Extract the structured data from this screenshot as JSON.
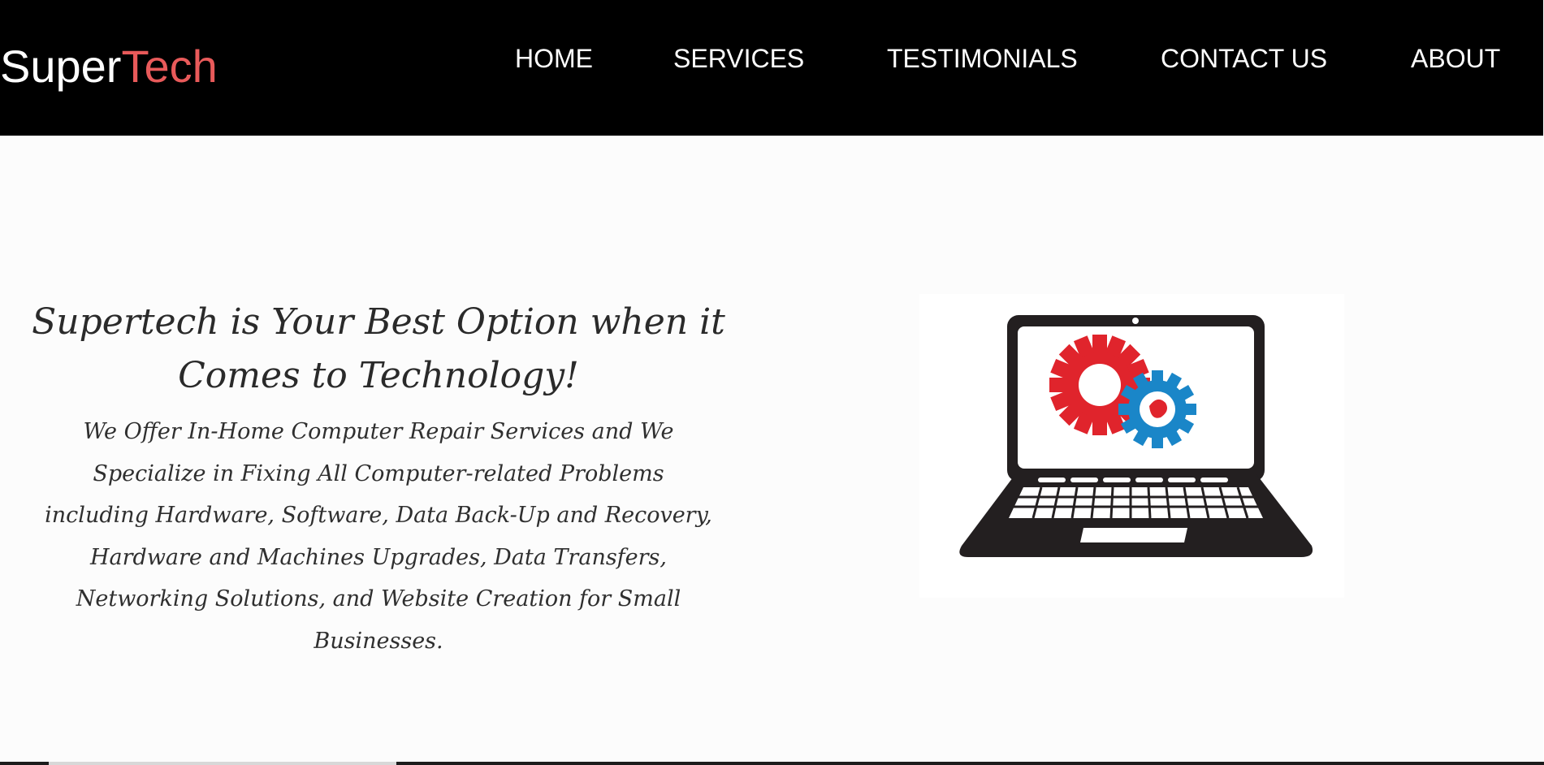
{
  "brand": {
    "logo_part1": "Super",
    "logo_part2": "Tech",
    "accent_color": "#e85a5a"
  },
  "nav": {
    "items": [
      {
        "label": "HOME"
      },
      {
        "label": "SERVICES"
      },
      {
        "label": "TESTIMONIALS"
      },
      {
        "label": "CONTACT US"
      },
      {
        "label": "ABOUT"
      }
    ]
  },
  "hero": {
    "title": "Supertech is Your Best Option when it Comes to Technology!",
    "description": "We Offer In-Home Computer Repair Services and We Specialize in Fixing All Computer-related Problems including Hardware, Software, Data Back-Up and Recovery, Hardware and Machines Upgrades, Data Transfers, Networking Solutions, and Website Creation for Small Businesses.",
    "image": {
      "icon": "laptop-gears-icon",
      "gear_colors": [
        "#e0242c",
        "#1a86c8"
      ]
    }
  }
}
